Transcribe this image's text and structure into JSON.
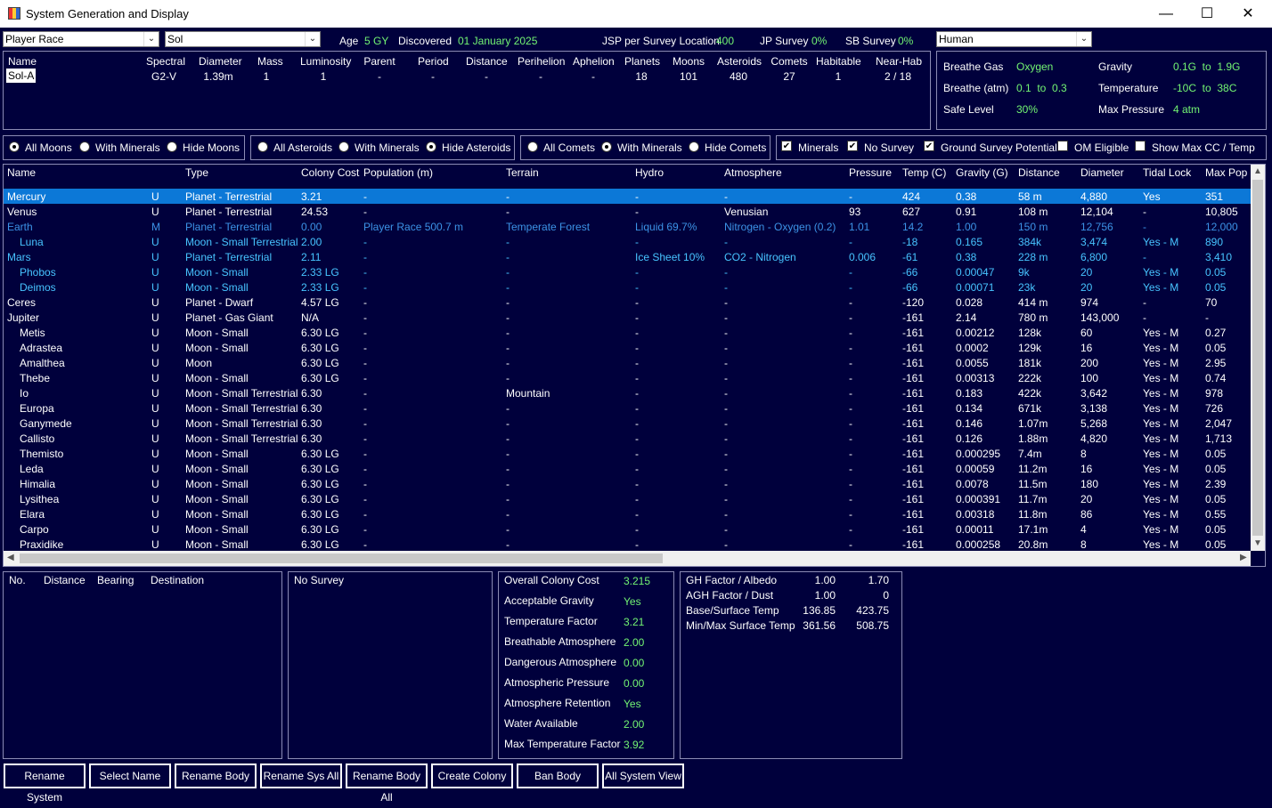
{
  "window": {
    "title": "System Generation and Display"
  },
  "top": {
    "race_select": "Player Race",
    "system_select": "Sol",
    "age_label": "Age",
    "age_value": "5 GY",
    "discovered_label": "Discovered",
    "discovered_value": "01 January 2025",
    "jsp_label": "JSP per Survey Location",
    "jsp_value": "400",
    "jp_label": "JP Survey",
    "jp_value": "0%",
    "sb_label": "SB Survey",
    "sb_value": "0%",
    "species_select": "Human"
  },
  "star": {
    "headers": [
      "Name",
      "Spectral",
      "Diameter",
      "Mass",
      "Luminosity",
      "Parent",
      "Period",
      "Distance",
      "Perihelion",
      "Aphelion",
      "Planets",
      "Moons",
      "Asteroids",
      "Comets",
      "Habitable",
      "Near-Hab"
    ],
    "values": [
      "Sol-A",
      "G2-V",
      "1.39m",
      "1",
      "1",
      "-",
      "-",
      "-",
      "-",
      "-",
      "18",
      "101",
      "480",
      "27",
      "1",
      "2 / 18"
    ]
  },
  "env": {
    "breathe_gas_label": "Breathe Gas",
    "breathe_gas_value": "Oxygen",
    "gravity_label": "Gravity",
    "gravity_value": "0.1G  to  1.9G",
    "breathe_atm_label": "Breathe (atm)",
    "breathe_atm_value": "0.1  to  0.3",
    "temperature_label": "Temperature",
    "temperature_value": "-10C  to  38C",
    "safe_label": "Safe Level",
    "safe_value": "30%",
    "maxp_label": "Max Pressure",
    "maxp_value": "4 atm"
  },
  "filters": {
    "moons": [
      "All Moons",
      "With Minerals",
      "Hide Moons"
    ],
    "asteroids": [
      "All Asteroids",
      "With Minerals",
      "Hide Asteroids"
    ],
    "comets": [
      "All Comets",
      "With Minerals",
      "Hide Comets"
    ],
    "checks": [
      "Minerals",
      "No Survey",
      "Ground Survey Potential",
      "OM Eligible",
      "Show Max CC / Temp"
    ]
  },
  "table": {
    "headers": [
      "Name",
      "Type",
      "Colony Cost",
      "Population (m)",
      "Terrain",
      "Hydro",
      "Atmosphere",
      "Pressure",
      "Temp (C)",
      "Gravity (G)",
      "Distance",
      "Diameter",
      "Tidal Lock",
      "Max Pop"
    ],
    "rows": [
      {
        "c": "white",
        "sel": true,
        "d": [
          "Mercury",
          "U",
          "Planet - Terrestrial",
          "3.21",
          "-",
          "-",
          "-",
          "-",
          "-",
          "424",
          "0.38",
          "58 m",
          "4,880",
          "Yes",
          "351"
        ]
      },
      {
        "c": "white",
        "d": [
          "Venus",
          "U",
          "Planet - Terrestrial",
          "24.53",
          "-",
          "-",
          "-",
          "Venusian",
          "93",
          "627",
          "0.91",
          "108 m",
          "12,104",
          "-",
          "10,805"
        ]
      },
      {
        "c": "ltblue",
        "d": [
          "Earth",
          "M",
          "Planet - Terrestrial",
          "0.00",
          "Player Race 500.7 m",
          "Temperate Forest",
          "Liquid 69.7%",
          "Nitrogen - Oxygen (0.2)",
          "1.01",
          "14.2",
          "1.00",
          "150 m",
          "12,756",
          "-",
          "12,000"
        ]
      },
      {
        "c": "cyan",
        "moon": true,
        "d": [
          "Luna",
          "U",
          "Moon - Small Terrestrial",
          "2.00",
          "-",
          "-",
          "-",
          "-",
          "-",
          "-18",
          "0.165",
          "384k",
          "3,474",
          "Yes - M",
          "890"
        ]
      },
      {
        "c": "cyan",
        "d": [
          "Mars",
          "U",
          "Planet - Terrestrial",
          "2.11",
          "-",
          "-",
          "Ice Sheet 10%",
          "CO2 - Nitrogen",
          "0.006",
          "-61",
          "0.38",
          "228 m",
          "6,800",
          "-",
          "3,410"
        ]
      },
      {
        "c": "cyan",
        "moon": true,
        "d": [
          "Phobos",
          "U",
          "Moon - Small",
          "2.33 LG",
          "-",
          "-",
          "-",
          "-",
          "-",
          "-66",
          "0.00047",
          "9k",
          "20",
          "Yes - M",
          "0.05"
        ]
      },
      {
        "c": "cyan",
        "moon": true,
        "d": [
          "Deimos",
          "U",
          "Moon - Small",
          "2.33 LG",
          "-",
          "-",
          "-",
          "-",
          "-",
          "-66",
          "0.00071",
          "23k",
          "20",
          "Yes - M",
          "0.05"
        ]
      },
      {
        "c": "white",
        "d": [
          "Ceres",
          "U",
          "Planet - Dwarf",
          "4.57 LG",
          "-",
          "-",
          "-",
          "-",
          "-",
          "-120",
          "0.028",
          "414 m",
          "974",
          "-",
          "70"
        ]
      },
      {
        "c": "white",
        "d": [
          "Jupiter",
          "U",
          "Planet - Gas Giant",
          "N/A",
          "-",
          "-",
          "-",
          "-",
          "-",
          "-161",
          "2.14",
          "780 m",
          "143,000",
          "-",
          "-"
        ]
      },
      {
        "c": "white",
        "moon": true,
        "d": [
          "Metis",
          "U",
          "Moon - Small",
          "6.30 LG",
          "-",
          "-",
          "-",
          "-",
          "-",
          "-161",
          "0.00212",
          "128k",
          "60",
          "Yes - M",
          "0.27"
        ]
      },
      {
        "c": "white",
        "moon": true,
        "d": [
          "Adrastea",
          "U",
          "Moon - Small",
          "6.30 LG",
          "-",
          "-",
          "-",
          "-",
          "-",
          "-161",
          "0.0002",
          "129k",
          "16",
          "Yes - M",
          "0.05"
        ]
      },
      {
        "c": "white",
        "moon": true,
        "d": [
          "Amalthea",
          "U",
          "Moon",
          "6.30 LG",
          "-",
          "-",
          "-",
          "-",
          "-",
          "-161",
          "0.0055",
          "181k",
          "200",
          "Yes - M",
          "2.95"
        ]
      },
      {
        "c": "white",
        "moon": true,
        "d": [
          "Thebe",
          "U",
          "Moon - Small",
          "6.30 LG",
          "-",
          "-",
          "-",
          "-",
          "-",
          "-161",
          "0.00313",
          "222k",
          "100",
          "Yes - M",
          "0.74"
        ]
      },
      {
        "c": "white",
        "moon": true,
        "d": [
          "Io",
          "U",
          "Moon - Small Terrestrial",
          "6.30",
          "-",
          "Mountain",
          "-",
          "-",
          "-",
          "-161",
          "0.183",
          "422k",
          "3,642",
          "Yes - M",
          "978"
        ]
      },
      {
        "c": "white",
        "moon": true,
        "d": [
          "Europa",
          "U",
          "Moon - Small Terrestrial",
          "6.30",
          "-",
          "-",
          "-",
          "-",
          "-",
          "-161",
          "0.134",
          "671k",
          "3,138",
          "Yes - M",
          "726"
        ]
      },
      {
        "c": "white",
        "moon": true,
        "d": [
          "Ganymede",
          "U",
          "Moon - Small Terrestrial",
          "6.30",
          "-",
          "-",
          "-",
          "-",
          "-",
          "-161",
          "0.146",
          "1.07m",
          "5,268",
          "Yes - M",
          "2,047"
        ]
      },
      {
        "c": "white",
        "moon": true,
        "d": [
          "Callisto",
          "U",
          "Moon - Small Terrestrial",
          "6.30",
          "-",
          "-",
          "-",
          "-",
          "-",
          "-161",
          "0.126",
          "1.88m",
          "4,820",
          "Yes - M",
          "1,713"
        ]
      },
      {
        "c": "white",
        "moon": true,
        "d": [
          "Themisto",
          "U",
          "Moon - Small",
          "6.30 LG",
          "-",
          "-",
          "-",
          "-",
          "-",
          "-161",
          "0.000295",
          "7.4m",
          "8",
          "Yes - M",
          "0.05"
        ]
      },
      {
        "c": "white",
        "moon": true,
        "d": [
          "Leda",
          "U",
          "Moon - Small",
          "6.30 LG",
          "-",
          "-",
          "-",
          "-",
          "-",
          "-161",
          "0.00059",
          "11.2m",
          "16",
          "Yes - M",
          "0.05"
        ]
      },
      {
        "c": "white",
        "moon": true,
        "d": [
          "Himalia",
          "U",
          "Moon - Small",
          "6.30 LG",
          "-",
          "-",
          "-",
          "-",
          "-",
          "-161",
          "0.0078",
          "11.5m",
          "180",
          "Yes - M",
          "2.39"
        ]
      },
      {
        "c": "white",
        "moon": true,
        "d": [
          "Lysithea",
          "U",
          "Moon - Small",
          "6.30 LG",
          "-",
          "-",
          "-",
          "-",
          "-",
          "-161",
          "0.000391",
          "11.7m",
          "20",
          "Yes - M",
          "0.05"
        ]
      },
      {
        "c": "white",
        "moon": true,
        "d": [
          "Elara",
          "U",
          "Moon - Small",
          "6.30 LG",
          "-",
          "-",
          "-",
          "-",
          "-",
          "-161",
          "0.00318",
          "11.8m",
          "86",
          "Yes - M",
          "0.55"
        ]
      },
      {
        "c": "white",
        "moon": true,
        "d": [
          "Carpo",
          "U",
          "Moon - Small",
          "6.30 LG",
          "-",
          "-",
          "-",
          "-",
          "-",
          "-161",
          "0.00011",
          "17.1m",
          "4",
          "Yes - M",
          "0.05"
        ]
      },
      {
        "c": "white",
        "moon": true,
        "d": [
          "Praxidike",
          "U",
          "Moon - Small",
          "6.30 LG",
          "-",
          "-",
          "-",
          "-",
          "-",
          "-161",
          "0.000258",
          "20.8m",
          "8",
          "Yes - M",
          "0.05"
        ]
      }
    ]
  },
  "jumps": {
    "headers": [
      "No.",
      "Distance",
      "Bearing",
      "Destination"
    ]
  },
  "survey": {
    "text": "No Survey"
  },
  "colony": {
    "labels": [
      "Overall Colony Cost",
      "Acceptable Gravity",
      "Temperature Factor",
      "Breathable Atmosphere",
      "Dangerous Atmosphere",
      "Atmospheric Pressure",
      "Atmosphere Retention",
      "Water Available",
      "Max Temperature Factor"
    ],
    "values": [
      "3.215",
      "Yes",
      "3.21",
      "2.00",
      "0.00",
      "0.00",
      "Yes",
      "2.00",
      "3.92"
    ]
  },
  "factors": {
    "rows": [
      [
        "GH Factor / Albedo",
        "1.00",
        "1.70"
      ],
      [
        "AGH Factor / Dust",
        "1.00",
        "0"
      ],
      [
        "Base/Surface Temp",
        "136.85",
        "423.75"
      ],
      [
        "Min/Max Surface Temp",
        "361.56",
        "508.75"
      ]
    ]
  },
  "buttons": [
    "Rename System",
    "Select Name",
    "Rename Body",
    "Rename Sys All",
    "Rename Body All",
    "Create Colony",
    "Ban Body",
    "All System View"
  ]
}
